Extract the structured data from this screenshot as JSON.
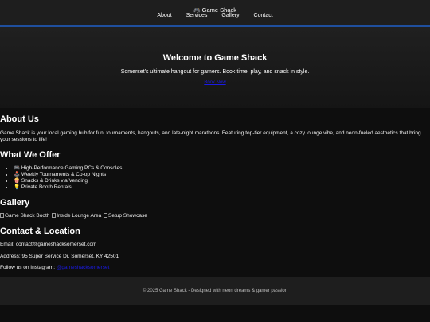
{
  "header": {
    "brand_icon": "🎮",
    "brand_name": "Game Shack",
    "nav": [
      "About",
      "Services",
      "Gallery",
      "Contact"
    ]
  },
  "hero": {
    "title": "Welcome to Game Shack",
    "tagline": "Somerset's ultimate hangout for gamers. Book time, play, and snack in style.",
    "cta_label": "Book Now"
  },
  "about": {
    "heading": "About Us",
    "text": "Game Shack is your local gaming hub for fun, tournaments, hangouts, and late-night marathons. Featuring top-tier equipment, a cozy lounge vibe, and neon-fueled aesthetics that bring your sessions to life!"
  },
  "offers": {
    "heading": "What We Offer",
    "items": [
      {
        "icon": "🎮",
        "text": "High-Performance Gaming PCs & Consoles"
      },
      {
        "icon": "🕹️",
        "text": "Weekly Tournaments & Co-op Nights"
      },
      {
        "icon": "🍿",
        "text": "Snacks & Drinks via Vending"
      },
      {
        "icon": "💡",
        "text": "Private Booth Rentals"
      }
    ]
  },
  "gallery": {
    "heading": "Gallery",
    "images": [
      "Game Shack Booth",
      "Inside Lounge Area",
      "Setup Showcase"
    ]
  },
  "contact": {
    "heading": "Contact & Location",
    "email_line": "Email: contact@gameshacksomerset.com",
    "address_line": "Address: 95 Super Service Dr, Somerset, KY 42501",
    "instagram_prefix": "Follow us on Instagram: ",
    "instagram_handle": "@gameshacksomerset"
  },
  "footer": {
    "text": "© 2025 Game Shack - Designed with neon dreams & gamer passion"
  },
  "colors": {
    "accent": "#1f4f9e",
    "link": "#1a1ae6",
    "background": "#0e0e0e"
  }
}
